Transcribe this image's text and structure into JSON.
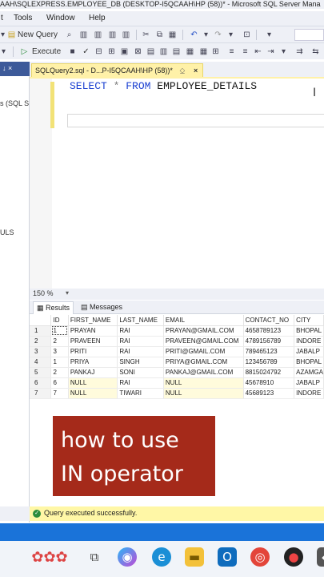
{
  "window": {
    "title": "AAH\\SQLEXPRESS.EMPLOYEE_DB (DESKTOP-I5QCAAH\\HP (58))* - Microsoft SQL Server Mana"
  },
  "menu": {
    "items": [
      "t",
      "Tools",
      "Window",
      "Help"
    ]
  },
  "toolbar": {
    "new_query_label": "New Query",
    "execute_label": "Execute"
  },
  "object_explorer": {
    "pin_glyph": "↓ ×",
    "item1": "s (SQL S",
    "item2": "ULS"
  },
  "query_tab": {
    "label": "SQLQuery2.sql - D...P-I5QCAAH\\HP (58))*",
    "pin": "⎐",
    "close": "×"
  },
  "editor": {
    "kw_select": "SELECT",
    "star": "*",
    "kw_from": "FROM",
    "table": "EMPLOYEE_DETAILS"
  },
  "zoom": {
    "level": "150 %"
  },
  "result_tabs": {
    "results": "Results",
    "messages": "Messages"
  },
  "results": {
    "columns": [
      "",
      "ID",
      "FIRST_NAME",
      "LAST_NAME",
      "EMAIL",
      "CONTACT_NO",
      "CITY"
    ],
    "rows": [
      [
        "1",
        "1",
        "PRAYAN",
        "RAI",
        "PRAYAN@GMAIL.COM",
        "4658789123",
        "BHOPAL"
      ],
      [
        "2",
        "2",
        "PRAVEEN",
        "RAI",
        "PRAVEEN@GMAIL.COM",
        "4789156789",
        "INDORE"
      ],
      [
        "3",
        "3",
        "PRITI",
        "RAI",
        "PRITI@GMAIL.COM",
        "789465123",
        "JABALP"
      ],
      [
        "4",
        "1",
        "PRIYA",
        "SINGH",
        "PRIYA@GMAIL.COM",
        "123456789",
        "BHOPAL"
      ],
      [
        "5",
        "2",
        "PANKAJ",
        "SONI",
        "PANKAJ@GMAIL.COM",
        "8815024792",
        "AZAMGA"
      ],
      [
        "6",
        "6",
        "NULL",
        "RAI",
        "NULL",
        "45678910",
        "JABALP"
      ],
      [
        "7",
        "7",
        "NULL",
        "TIWARI",
        "NULL",
        "45689123",
        "INDORE"
      ]
    ]
  },
  "overlay": {
    "text": "how to use\nIN operator"
  },
  "status": {
    "message": "Query executed successfully."
  },
  "colors": {
    "accent": "#1a73d9",
    "overlay_bg": "#a52a1a",
    "status_bg": "#fff7a6",
    "keyword": "#1a3fd1"
  },
  "taskbar": {
    "icons": [
      "flowers-widget-icon",
      "task-view-icon",
      "copilot-icon",
      "edge-icon",
      "file-explorer-icon",
      "outlook-icon",
      "chrome-icon",
      "app-icon",
      "app-icon-2"
    ]
  }
}
